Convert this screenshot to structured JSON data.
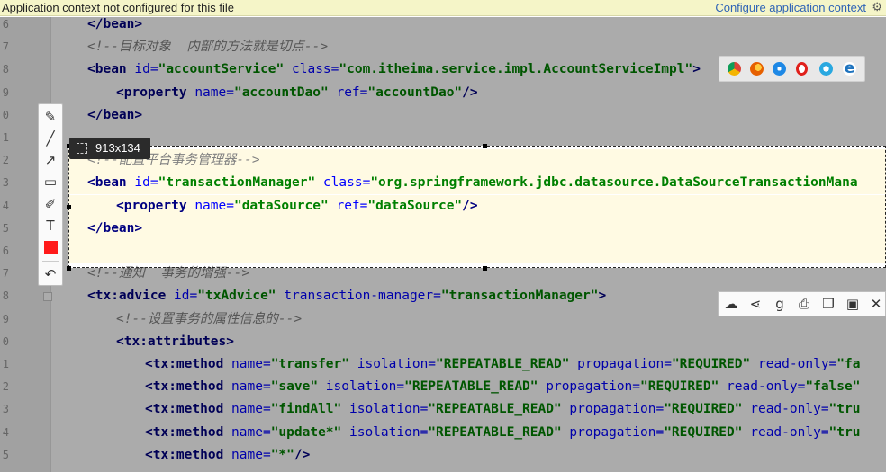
{
  "notification": {
    "message": "Application context not configured for this file",
    "action": "Configure application context",
    "gear_icon": "gear-icon"
  },
  "editor": {
    "lines": [
      {
        "num": "6",
        "segments": [
          {
            "t": "</bean>",
            "c": "tag"
          }
        ],
        "indent": 0
      },
      {
        "num": "7",
        "segments": [
          {
            "t": "<!--目标对象  内部的方法就是切点-->",
            "c": "comment"
          }
        ],
        "indent": 0
      },
      {
        "num": "8",
        "segments": [
          {
            "t": "<bean ",
            "c": "tag"
          },
          {
            "t": "id=",
            "c": "attr"
          },
          {
            "t": "\"accountService\"",
            "c": "val"
          },
          {
            "t": " class=",
            "c": "attr"
          },
          {
            "t": "\"com.itheima.service.impl.AccountServiceImpl\"",
            "c": "val"
          },
          {
            "t": ">",
            "c": "tag"
          }
        ],
        "indent": 0
      },
      {
        "num": "9",
        "segments": [
          {
            "t": "<property ",
            "c": "tag"
          },
          {
            "t": "name=",
            "c": "attr"
          },
          {
            "t": "\"accountDao\"",
            "c": "val"
          },
          {
            "t": " ref=",
            "c": "attr"
          },
          {
            "t": "\"accountDao\"",
            "c": "val"
          },
          {
            "t": "/>",
            "c": "tag"
          }
        ],
        "indent": 1
      },
      {
        "num": "0",
        "segments": [
          {
            "t": "</bean>",
            "c": "tag"
          }
        ],
        "indent": 0
      },
      {
        "num": "1",
        "segments": [],
        "indent": 0
      },
      {
        "num": "2",
        "segments": [
          {
            "t": "<!--配置平台事务管理器-->",
            "c": "comment"
          }
        ],
        "indent": 0
      },
      {
        "num": "3",
        "segments": [
          {
            "t": "<bean ",
            "c": "tag"
          },
          {
            "t": "id=",
            "c": "attr"
          },
          {
            "t": "\"transactionManager\"",
            "c": "val"
          },
          {
            "t": " class=",
            "c": "attr"
          },
          {
            "t": "\"org.springframework.jdbc.datasource.DataSourceTransactionMana",
            "c": "val"
          }
        ],
        "indent": 0
      },
      {
        "num": "4",
        "segments": [
          {
            "t": "<property ",
            "c": "tag"
          },
          {
            "t": "name=",
            "c": "attr"
          },
          {
            "t": "\"dataSource\"",
            "c": "val"
          },
          {
            "t": " ref=",
            "c": "attr"
          },
          {
            "t": "\"dataSource\"",
            "c": "val"
          },
          {
            "t": "/>",
            "c": "tag"
          }
        ],
        "indent": 1
      },
      {
        "num": "5",
        "segments": [
          {
            "t": "</bean>",
            "c": "tag"
          }
        ],
        "indent": 0
      },
      {
        "num": "6",
        "segments": [],
        "indent": 0
      },
      {
        "num": "7",
        "segments": [
          {
            "t": "<!--通知  事务的增强-->",
            "c": "comment"
          }
        ],
        "indent": 0
      },
      {
        "num": "8",
        "segments": [
          {
            "t": "<tx:advice ",
            "c": "tag"
          },
          {
            "t": "id=",
            "c": "attr"
          },
          {
            "t": "\"txAdvice\"",
            "c": "val"
          },
          {
            "t": " transaction-manager=",
            "c": "attr"
          },
          {
            "t": "\"transactionManager\"",
            "c": "val"
          },
          {
            "t": ">",
            "c": "tag"
          }
        ],
        "indent": 0
      },
      {
        "num": "9",
        "segments": [
          {
            "t": "<!--设置事务的属性信息的-->",
            "c": "comment"
          }
        ],
        "indent": 1
      },
      {
        "num": "0",
        "segments": [
          {
            "t": "<tx:attributes>",
            "c": "tag"
          }
        ],
        "indent": 1
      },
      {
        "num": "1",
        "segments": [
          {
            "t": "<tx:method ",
            "c": "tag"
          },
          {
            "t": "name=",
            "c": "attr"
          },
          {
            "t": "\"transfer\"",
            "c": "val"
          },
          {
            "t": " isolation=",
            "c": "attr"
          },
          {
            "t": "\"REPEATABLE_READ\"",
            "c": "val"
          },
          {
            "t": " propagation=",
            "c": "attr"
          },
          {
            "t": "\"REQUIRED\"",
            "c": "val"
          },
          {
            "t": " read-only=",
            "c": "attr"
          },
          {
            "t": "\"fa",
            "c": "val"
          }
        ],
        "indent": 2
      },
      {
        "num": "2",
        "segments": [
          {
            "t": "<tx:method ",
            "c": "tag"
          },
          {
            "t": "name=",
            "c": "attr"
          },
          {
            "t": "\"save\"",
            "c": "val"
          },
          {
            "t": " isolation=",
            "c": "attr"
          },
          {
            "t": "\"REPEATABLE_READ\"",
            "c": "val"
          },
          {
            "t": " propagation=",
            "c": "attr"
          },
          {
            "t": "\"REQUIRED\"",
            "c": "val"
          },
          {
            "t": " read-only=",
            "c": "attr"
          },
          {
            "t": "\"false\"",
            "c": "val"
          }
        ],
        "indent": 2
      },
      {
        "num": "3",
        "segments": [
          {
            "t": "<tx:method ",
            "c": "tag"
          },
          {
            "t": "name=",
            "c": "attr"
          },
          {
            "t": "\"findAll\"",
            "c": "val"
          },
          {
            "t": " isolation=",
            "c": "attr"
          },
          {
            "t": "\"REPEATABLE_READ\"",
            "c": "val"
          },
          {
            "t": " propagation=",
            "c": "attr"
          },
          {
            "t": "\"REQUIRED\"",
            "c": "val"
          },
          {
            "t": " read-only=",
            "c": "attr"
          },
          {
            "t": "\"tru",
            "c": "val"
          }
        ],
        "indent": 2
      },
      {
        "num": "4",
        "segments": [
          {
            "t": "<tx:method ",
            "c": "tag"
          },
          {
            "t": "name=",
            "c": "attr"
          },
          {
            "t": "\"update*\"",
            "c": "val"
          },
          {
            "t": " isolation=",
            "c": "attr"
          },
          {
            "t": "\"REPEATABLE_READ\"",
            "c": "val"
          },
          {
            "t": " propagation=",
            "c": "attr"
          },
          {
            "t": "\"REQUIRED\"",
            "c": "val"
          },
          {
            "t": " read-only=",
            "c": "attr"
          },
          {
            "t": "\"tru",
            "c": "val"
          }
        ],
        "indent": 2
      },
      {
        "num": "5",
        "segments": [
          {
            "t": "<tx:method ",
            "c": "tag"
          },
          {
            "t": "name=",
            "c": "attr"
          },
          {
            "t": "\"*\"",
            "c": "val"
          },
          {
            "t": "/>",
            "c": "tag"
          }
        ],
        "indent": 2
      }
    ]
  },
  "capture": {
    "size_label": "913x134"
  },
  "left_toolbar": {
    "tools": [
      {
        "name": "pen-icon",
        "glyph": "✎"
      },
      {
        "name": "line-icon",
        "glyph": "╱"
      },
      {
        "name": "arrow-icon",
        "glyph": "↗"
      },
      {
        "name": "rectangle-icon",
        "glyph": "▭"
      },
      {
        "name": "marker-icon",
        "glyph": "✐"
      },
      {
        "name": "text-icon",
        "glyph": "T"
      },
      {
        "name": "color-swatch-icon",
        "glyph": ""
      },
      {
        "name": "undo-icon",
        "glyph": "↶"
      }
    ],
    "swatch_color": "#ff1a1a"
  },
  "browser_icons": [
    "chrome-icon",
    "firefox-icon",
    "safari-icon",
    "opera-icon",
    "ie-icon",
    "edge-icon"
  ],
  "bottom_toolbar": {
    "actions": [
      {
        "name": "cloud-upload-icon",
        "glyph": "☁"
      },
      {
        "name": "share-icon",
        "glyph": "<"
      },
      {
        "name": "google-icon",
        "glyph": "g"
      },
      {
        "name": "print-icon",
        "glyph": "⎙"
      },
      {
        "name": "copy-icon",
        "glyph": "❐"
      },
      {
        "name": "save-icon",
        "glyph": "▣"
      },
      {
        "name": "close-icon",
        "glyph": "✕"
      }
    ]
  }
}
